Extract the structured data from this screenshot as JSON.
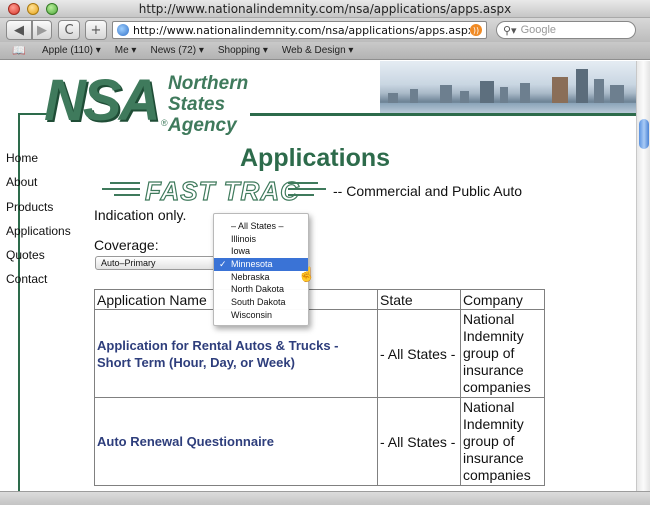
{
  "window": {
    "title": "http://www.nationalindemnity.com/nsa/applications/apps.aspx"
  },
  "toolbar": {
    "back": "◀",
    "forward": "▶",
    "reload": "C",
    "add": "+",
    "url": "http://www.nationalindemnity.com/nsa/applications/apps.aspx",
    "search_placeholder": "Google"
  },
  "bookmarks": [
    "Apple (110) ▾",
    "Me ▾",
    "News (72) ▾",
    "Shopping ▾",
    "Web & Design ▾"
  ],
  "logo": {
    "mark": "NSA",
    "reg": "®",
    "line1": "Northern",
    "line2": "States",
    "line3": "Agency"
  },
  "nav": [
    "Home",
    "About",
    "Products",
    "Applications",
    "Quotes",
    "Contact"
  ],
  "page": {
    "title": "Applications",
    "fasttrac": "FAST TRAC",
    "fasttrac_suffix": "-- Commercial and Public Auto",
    "indication": "Indication only.",
    "coverage_label": "Coverage:",
    "coverage_value": "Auto–Primary"
  },
  "table": {
    "headers": [
      "Application Name",
      "State",
      "Company"
    ],
    "rows": [
      {
        "name": "Application for Rental Autos & Trucks - Short Term (Hour, Day, or Week)",
        "state": "- All States -",
        "company": "National Indemnity group of insurance companies"
      },
      {
        "name": "Auto Renewal Questionnaire",
        "state": "- All States -",
        "company": "National Indemnity group of insurance companies"
      }
    ]
  },
  "state_menu": {
    "options": [
      "– All States –",
      "Illinois",
      "Iowa",
      "Minnesota",
      "Nebraska",
      "North Dakota",
      "South Dakota",
      "Wisconsin"
    ],
    "selected": "Minnesota",
    "check": "✓"
  },
  "colors": {
    "brand_green": "#3f7a5c",
    "link_blue": "#2e3e7c",
    "menu_highlight": "#3a73d6"
  }
}
